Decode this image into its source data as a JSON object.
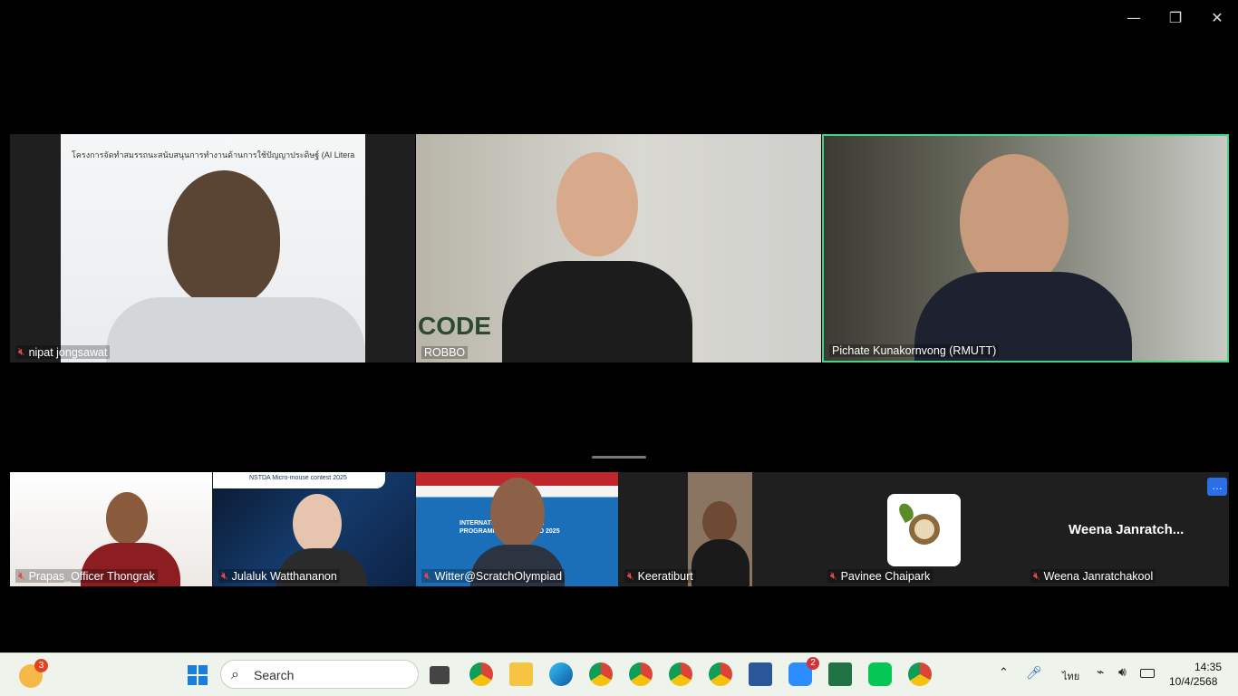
{
  "window": {
    "minimize_icon": "minimize-icon",
    "restore_icon": "restore-icon",
    "close_icon": "close-icon"
  },
  "main_tiles": [
    {
      "name": "nipat jongsawat",
      "muted": true,
      "slide_text": "โครงการจัดทำสมรรถนะสนับสนุนการทำงานด้านการใช้ปัญญาประดิษฐ์ (AI Litera"
    },
    {
      "name": "ROBBO",
      "muted": false,
      "bg_text": "CODE"
    },
    {
      "name": "Pichate Kunakornvong (RMUTT)",
      "muted": false,
      "active_speaker": true
    }
  ],
  "strip_tiles": [
    {
      "name": "Prapas_Officer Thongrak",
      "muted": true
    },
    {
      "name": "Julaluk Watthananon",
      "muted": true,
      "slide_text": "NSTDA Micro-mouse contest 2025"
    },
    {
      "name": "Witter@ScratchOlympiad",
      "muted": true,
      "slide_text": "INTERNATIONAL CREATIVE PROGRAMMING OLYMPIAD 2025"
    },
    {
      "name": "Keeratiburt",
      "muted": true
    },
    {
      "name": "Pavinee Chaipark",
      "muted": true
    },
    {
      "name": "Weena Janratchakool",
      "muted": true,
      "display": "Weena Janratch..."
    }
  ],
  "strip_more_icon": "more-options-icon",
  "taskbar": {
    "weather_badge": "3",
    "search_placeholder": "Search",
    "zoom_badge": "2",
    "lang": "ไทย",
    "time": "14:35",
    "date": "10/4/2568"
  },
  "colors": {
    "active_border": "#3dd68c",
    "mute_red": "#e5484d",
    "taskbar_bg": "#eef3ec"
  }
}
